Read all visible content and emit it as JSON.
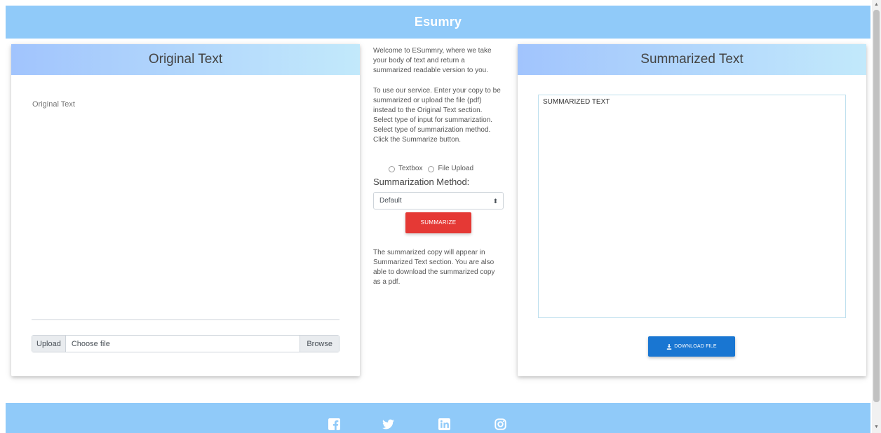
{
  "header": {
    "brand": "Esumry"
  },
  "original": {
    "title": "Original Text",
    "placeholder": "Original Text",
    "upload_label": "Upload",
    "file_placeholder": "Choose file",
    "browse_label": "Browse"
  },
  "middle": {
    "intro": "Welcome to ESummry, where we take your body of text and return a summarized readable version to you.",
    "instructions": "To use our service. Enter your copy to be summarized or upload the file (pdf) instead to the Original Text section. Select type of input for summarization. Select type of summarization method. Click the Summarize button.",
    "radio_options": [
      "Textbox",
      "File Upload"
    ],
    "method_label": "Summarization Method:",
    "method_selected": "Default",
    "summarize_label": "SUMMARIZE",
    "outro": "The summarized copy will appear in Summarized Text section. You are also able to download the summarized copy as a pdf."
  },
  "summarized": {
    "title": "Summarized Text",
    "content": "SUMMARIZED TEXT",
    "download_label": "DOWNLOAD FILE"
  },
  "footer": {
    "icons": [
      "facebook-icon",
      "twitter-icon",
      "linkedin-icon",
      "instagram-icon"
    ]
  },
  "colors": {
    "header_bg": "#90caf9",
    "summarize_btn": "#e53935",
    "download_btn": "#1976d2"
  }
}
